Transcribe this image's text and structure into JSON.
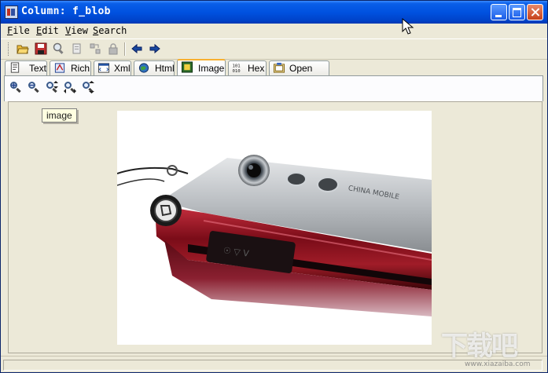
{
  "window": {
    "title": "Column: f_blob"
  },
  "menu": {
    "items": [
      "File",
      "Edit",
      "View",
      "Search"
    ]
  },
  "toolbar": {
    "icons": [
      "open-folder-icon",
      "save-icon",
      "find-icon",
      "copy-icon",
      "replace-icon",
      "lock-icon",
      "back-arrow-icon",
      "forward-arrow-icon"
    ]
  },
  "tabs": [
    {
      "label": "Text",
      "icon": "text-icon"
    },
    {
      "label": "Rich",
      "icon": "rich-text-icon"
    },
    {
      "label": "Xml",
      "icon": "xml-icon"
    },
    {
      "label": "Html",
      "icon": "html-icon"
    },
    {
      "label": "Image",
      "icon": "image-icon",
      "active": true
    },
    {
      "label": "Hex",
      "icon": "hex-icon"
    },
    {
      "label": "Open with",
      "icon": "open-with-icon"
    }
  ],
  "zoom_toolbar": {
    "icons": [
      "zoom-in-icon",
      "zoom-out-icon",
      "zoom-fit-icon",
      "zoom-width-icon",
      "zoom-actual-icon"
    ]
  },
  "tooltip": {
    "text": "image"
  },
  "watermark": {
    "text": "下载吧",
    "url": "www.xiazaiba.com"
  },
  "colors": {
    "titlebar": "#0052e0",
    "window_bg": "#ece9d8",
    "active_tab_highlight": "#f8b030"
  }
}
